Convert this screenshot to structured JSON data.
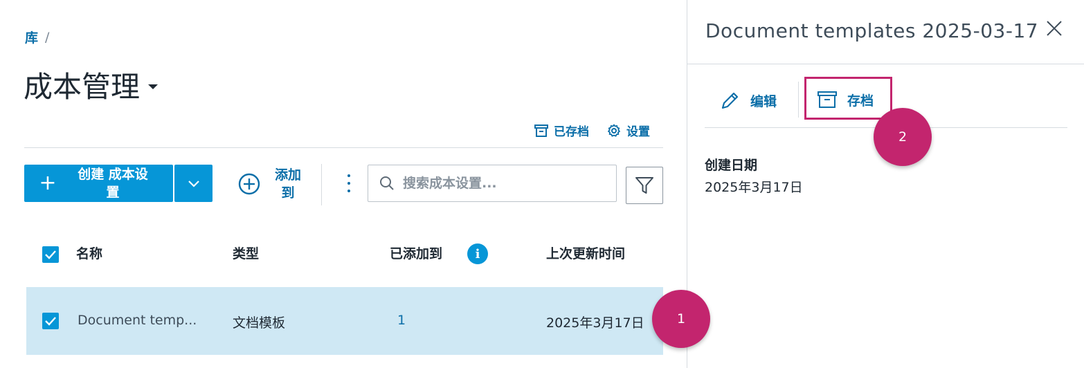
{
  "breadcrumb": {
    "root": "库",
    "separator": "/"
  },
  "page": {
    "title": "成本管理"
  },
  "top_links": {
    "archived": "已存档",
    "settings": "设置"
  },
  "toolbar": {
    "create_label": "创建 成本设置",
    "add_to_label": "添加到",
    "search_placeholder": "搜索成本设置..."
  },
  "table": {
    "headers": {
      "name": "名称",
      "type": "类型",
      "added_to": "已添加到",
      "updated": "上次更新时间"
    },
    "info_glyph": "i",
    "rows": [
      {
        "name": "Document temp...",
        "type": "文档模板",
        "added_to": "1",
        "updated": "2025年3月17日",
        "selected": true
      }
    ]
  },
  "panel": {
    "title": "Document templates 2025-03-17",
    "edit_label": "编辑",
    "archive_label": "存档",
    "created_label": "创建日期",
    "created_value": "2025年3月17日"
  },
  "callouts": {
    "one": "1",
    "two": "2"
  },
  "colors": {
    "primary": "#0696d7",
    "link": "#0b6ea8",
    "callout": "#c3256e",
    "row_selected": "#cfe8f4"
  }
}
